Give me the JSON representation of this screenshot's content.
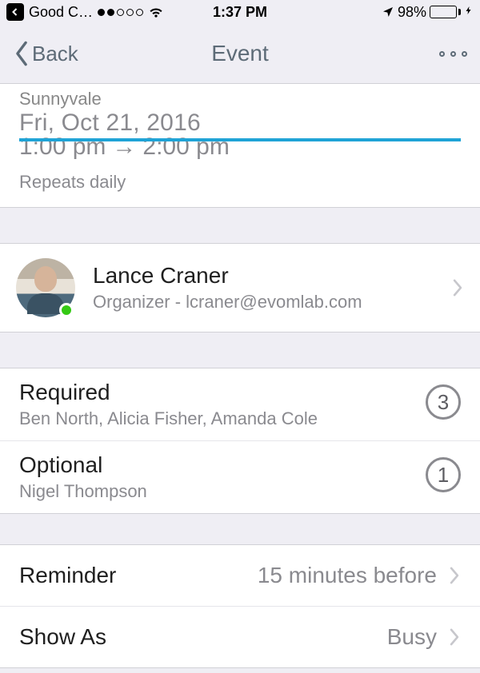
{
  "statusBar": {
    "carrier": "Good C…",
    "signalFilled": 2,
    "signalTotal": 5,
    "time": "1:37 PM",
    "batteryPercent": "98%",
    "batteryFill": 98
  },
  "nav": {
    "back": "Back",
    "title": "Event"
  },
  "event": {
    "location": "Sunnyvale",
    "date": "Fri, Oct 21, 2016",
    "timeStart": "1:00 pm",
    "timeEnd": "2:00 pm",
    "repeats": "Repeats daily"
  },
  "organizer": {
    "name": "Lance Craner",
    "subtitle": "Organizer - lcraner@evomlab.com"
  },
  "attendees": {
    "required": {
      "label": "Required",
      "names": "Ben North, Alicia Fisher, Amanda Cole",
      "count": "3"
    },
    "optional": {
      "label": "Optional",
      "names": "Nigel Thompson",
      "count": "1"
    }
  },
  "settings": {
    "reminder": {
      "label": "Reminder",
      "value": "15 minutes before"
    },
    "showAs": {
      "label": "Show As",
      "value": "Busy"
    }
  }
}
